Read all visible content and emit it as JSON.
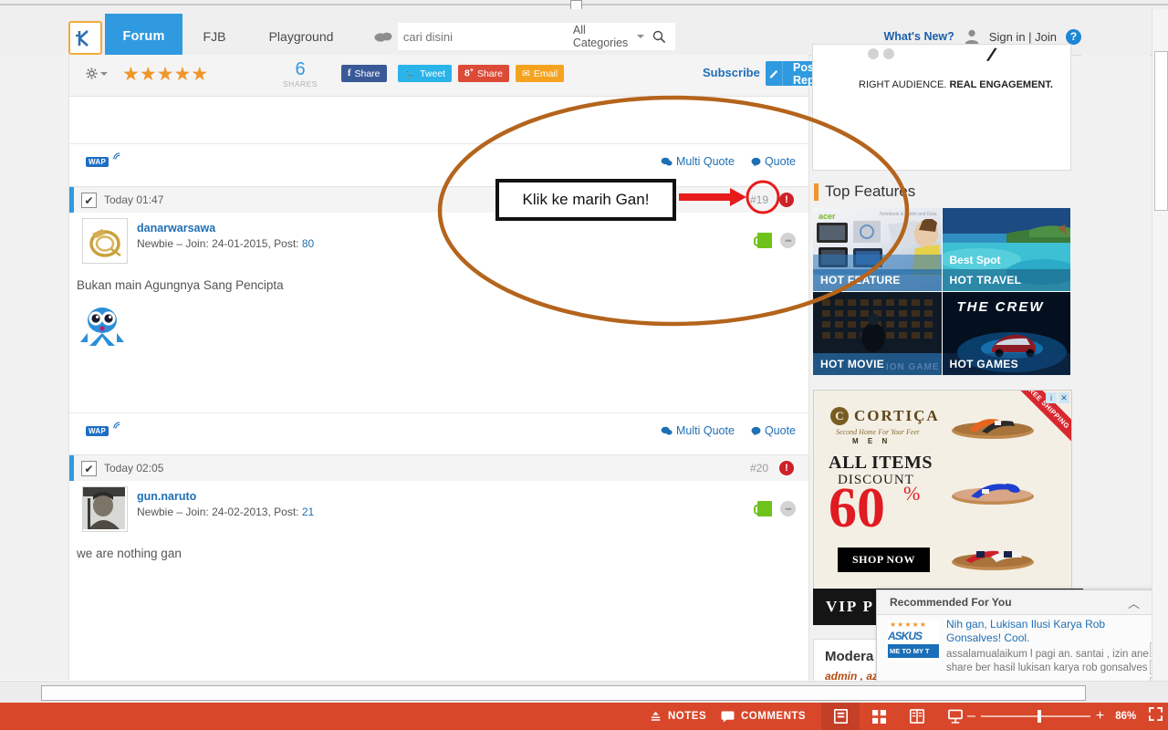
{
  "header": {
    "logo_alt": "Kaskus logo",
    "nav": [
      {
        "label": "Forum",
        "active": true
      },
      {
        "label": "FJB",
        "active": false
      },
      {
        "label": "Playground",
        "active": false
      }
    ],
    "search": {
      "placeholder": "cari disini",
      "value": "",
      "category": "All Categories"
    },
    "whats_new": "What's New?",
    "sign_in": "Sign in | Join",
    "help": "?"
  },
  "toolbar": {
    "rating_stars": 5,
    "shares_count": "6",
    "shares_label": "SHARES",
    "share_buttons": [
      {
        "label": "Share",
        "network": "facebook",
        "color": "#3a5a97"
      },
      {
        "label": "Tweet",
        "network": "twitter",
        "color": "#2ab3e8"
      },
      {
        "label": "Share",
        "network": "googleplus",
        "color": "#dc4a38"
      },
      {
        "label": "Email",
        "network": "email",
        "color": "#f5a31f"
      }
    ],
    "subscribe_label": "Subscribe",
    "post_reply_label": "Post Reply"
  },
  "previous_post_footer": {
    "wap_label": "WAP",
    "multi_quote": "Multi Quote",
    "quote": "Quote"
  },
  "posts": [
    {
      "time": "Today 01:47",
      "number": "#19",
      "username": "danarwarsawa",
      "rank": "Newbie",
      "join_label": "Join:",
      "join_date": "24-01-2015",
      "post_label": "Post:",
      "post_count": "80",
      "body": "Bukan main Agungnya Sang Pencipta",
      "footer": {
        "wap_label": "WAP",
        "multi_quote": "Multi Quote",
        "quote": "Quote"
      }
    },
    {
      "time": "Today 02:05",
      "number": "#20",
      "username": "gun.naruto",
      "rank": "Newbie",
      "join_label": "Join:",
      "join_date": "24-02-2013",
      "post_label": "Post:",
      "post_count": "21",
      "body": "we are nothing gan"
    }
  ],
  "annotation": {
    "callout_text": "Klik ke marih Gan!",
    "ellipse_color": "#b4641c",
    "arrow_color": "#e81b1b",
    "circle_color": "#e81b1b"
  },
  "sidebar": {
    "top_ad": {
      "tagline_light": "RIGHT AUDIENCE. ",
      "tagline_bold": "REAL ENGAGEMENT."
    },
    "section_title": "Top Features",
    "tiles": [
      {
        "caption": "HOT FEATURE",
        "brand": "acer",
        "sub": "Notebook & Tablet and Data"
      },
      {
        "caption": "HOT TRAVEL",
        "overlay": "Best Spot"
      },
      {
        "caption": "HOT MOVIE",
        "overlay": "ION GAME"
      },
      {
        "caption": "HOT GAMES",
        "overlay": "THE CREW"
      }
    ],
    "cortica_ad": {
      "brand": "CORTIÇA",
      "brand_initial": "C",
      "tagline": "Second Home For Your Feet",
      "segment": "M E N",
      "headline": "ALL ITEMS",
      "subhead": "DISCOUNT",
      "percent_number": "60",
      "percent_symbol": "%",
      "cta": "SHOP NOW",
      "ribbon": "FREE SHIPPING",
      "close_icons": [
        "i",
        "✕"
      ]
    },
    "vip_bar": "VIP P",
    "moderator": {
      "title": "Modera",
      "names": "admin , az"
    }
  },
  "recommended": {
    "title": "Recommended For You",
    "collapse_icon": "chevron-up",
    "item": {
      "title": "Nih gan, Lukisan Ilusi Karya Rob Gonsalves! Cool.",
      "snippet": "assalamualaikum l pagi an. santai , izin ane share ber hasil lukisan karya rob gonsalves",
      "thumb_label": "ASKUS",
      "thumb_sub": "ME TO MY T",
      "stars": "★★★★★"
    },
    "nav_buttons": [
      "▼",
      "▲",
      "▼"
    ]
  },
  "bottombar": {
    "notes": "NOTES",
    "comments": "COMMENTS",
    "view_icons": [
      "single-page-view",
      "grid-view",
      "book-view",
      "presentation-view"
    ],
    "zoom_out": "–",
    "zoom_in": "+",
    "zoom_level": "86%",
    "fullscreen": "fullscreen-icon"
  }
}
